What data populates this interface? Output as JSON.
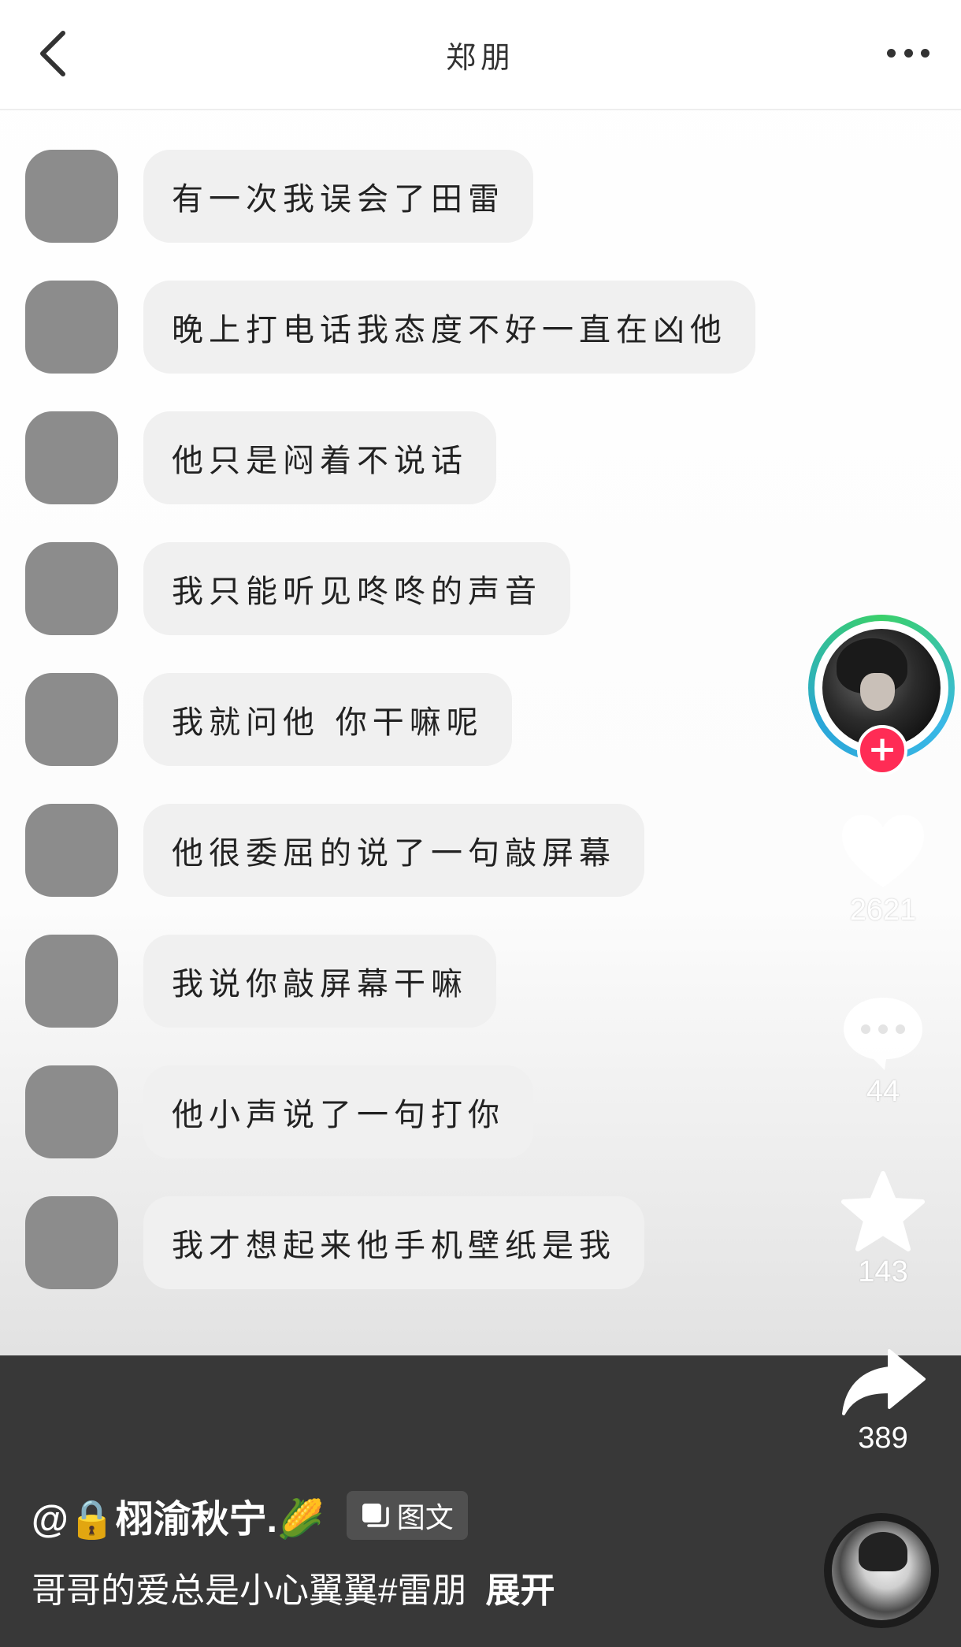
{
  "header": {
    "title": "郑朋",
    "back_icon": "chevron-left-icon",
    "more_icon": "more-dots-icon"
  },
  "messages": [
    {
      "text": "有一次我误会了田雷"
    },
    {
      "text": "晚上打电话我态度不好一直在凶他"
    },
    {
      "text": "他只是闷着不说话"
    },
    {
      "text": "我只能听见咚咚的声音"
    },
    {
      "text": "我就问他 你干嘛呢"
    },
    {
      "text": "他很委屈的说了一句敲屏幕"
    },
    {
      "text": "我说你敲屏幕干嘛"
    },
    {
      "text": "他小声说了一句打你"
    },
    {
      "text": "我才想起来他手机壁纸是我"
    }
  ],
  "rail": {
    "follow_label": "+",
    "likes": "2621",
    "comments": "44",
    "favorites": "143",
    "shares": "389"
  },
  "post": {
    "author": "@🔒栩渝秋宁.🌽",
    "tag_label": "图文",
    "caption": "哥哥的爱总是小心翼翼#雷朋",
    "expand_label": "展开"
  },
  "colors": {
    "follow_red": "#ff2c55",
    "ring_green": "#3ad06a",
    "ring_blue": "#3ab8e6",
    "bubble_bg": "#f0f0f0",
    "avatar_gray": "#8c8c8c",
    "panel_dark": "#383838"
  }
}
